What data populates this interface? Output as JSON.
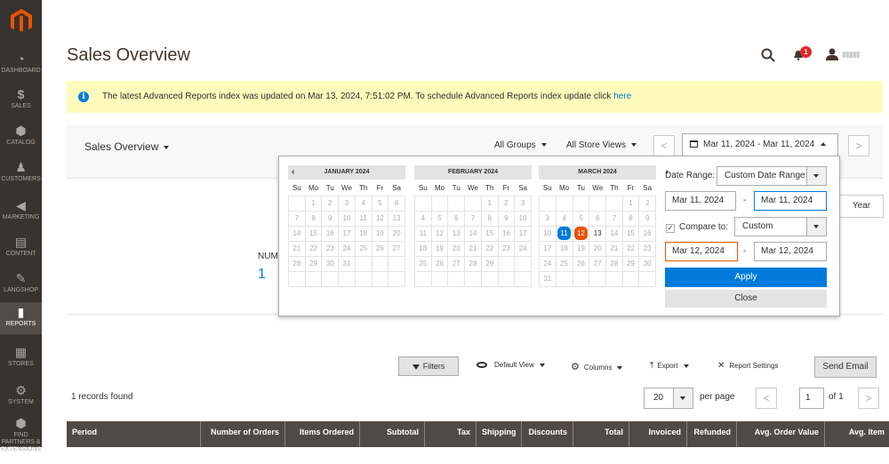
{
  "sidebar": {
    "items": [
      {
        "label": "DASHBOARD",
        "icon": "dashboard-icon"
      },
      {
        "label": "SALES",
        "icon": "dollar-icon"
      },
      {
        "label": "CATALOG",
        "icon": "cube-icon"
      },
      {
        "label": "CUSTOMERS",
        "icon": "person-icon"
      },
      {
        "label": "MARKETING",
        "icon": "megaphone-icon"
      },
      {
        "label": "CONTENT",
        "icon": "layout-icon"
      },
      {
        "label": "LANGSHOP",
        "icon": "langshop-icon"
      },
      {
        "label": "REPORTS",
        "icon": "bar-chart-icon"
      },
      {
        "label": "STORES",
        "icon": "store-icon"
      },
      {
        "label": "SYSTEM",
        "icon": "gear-icon"
      },
      {
        "label": "FIND PARTNERS & EXTENSIONS",
        "icon": "partners-icon"
      }
    ],
    "active": "REPORTS"
  },
  "header": {
    "title": "Sales Overview",
    "notifications_count": "1",
    "username": "▮▮▮▮▮"
  },
  "notice": {
    "text": "The latest Advanced Reports index was updated on Mar 13, 2024, 7:51:02 PM. To schedule Advanced Reports index update click ",
    "link": "here"
  },
  "toolbar": {
    "report_select": "Sales Overview",
    "groups_select": "All Groups",
    "store_views_select": "All Store Views",
    "date_button": "Mar 11, 2024 - Mar 11, 2024",
    "prev_label": "<",
    "next_label": ">"
  },
  "period": {
    "year_button": "Year"
  },
  "stats": {
    "label": "NUM",
    "value": "1"
  },
  "datepicker": {
    "weekdays": [
      "Su",
      "Mo",
      "Tu",
      "We",
      "Th",
      "Fr",
      "Sa"
    ],
    "months": [
      {
        "title": "JANUARY 2024",
        "start": 1,
        "days": 31
      },
      {
        "title": "FEBRUARY 2024",
        "start": 4,
        "days": 29
      },
      {
        "title": "MARCH 2024",
        "start": 5,
        "days": 31
      }
    ],
    "date_range_label": "Date Range:",
    "date_range_value": "Custom Date Range",
    "from_date": "Mar 11, 2024",
    "to_date": "Mar 11, 2024",
    "compare_label": "Compare to:",
    "compare_value": "Custom",
    "compare_from": "Mar 12, 2024",
    "compare_to": "Mar 12, 2024",
    "apply_label": "Apply",
    "close_label": "Close",
    "dash": "-"
  },
  "grid_toolbar": {
    "filters": "Filters",
    "default_view": "Default View",
    "columns": "Columns",
    "export": "Export",
    "report_settings": "Report Settings",
    "send_email": "Send Email",
    "records_found": "1 records found",
    "per_page_value": "20",
    "per_page_label": "per page",
    "page": "1",
    "of_pages": "of 1"
  },
  "table": {
    "columns": [
      "Period",
      "Number of Orders",
      "Items Ordered",
      "Subtotal",
      "Tax",
      "Shipping",
      "Discounts",
      "Total",
      "Invoiced",
      "Refunded",
      "Avg. Order Value",
      "Avg. Item Final Price"
    ]
  },
  "colors": {
    "accent": "#007bdb",
    "compare": "#eb5202",
    "sidebar": "#373330",
    "brand": "#eb5202"
  }
}
